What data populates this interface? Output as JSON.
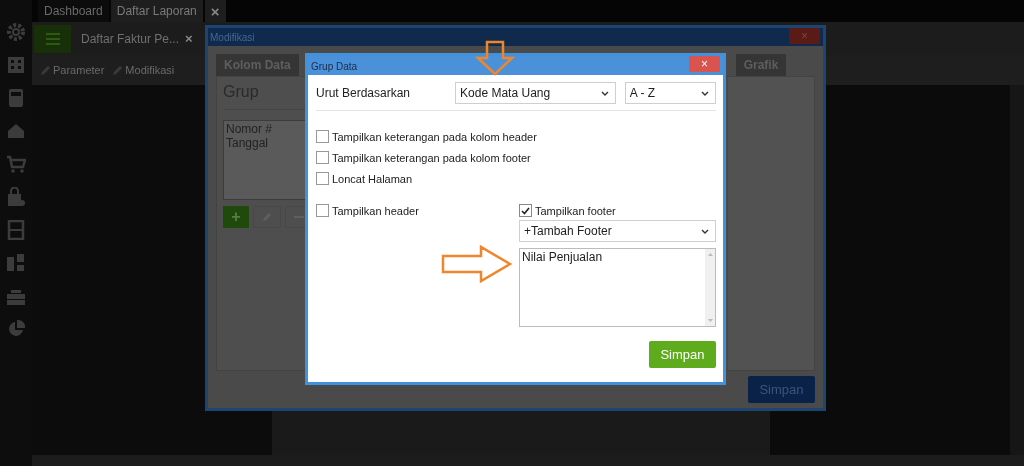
{
  "app_tabs": [
    {
      "label": "Dashboard",
      "selected": false
    },
    {
      "label": "Daftar Laporan",
      "selected": true
    }
  ],
  "app_tab_close": "×",
  "report_tab": {
    "title": "Daftar Faktur Pe...",
    "close": "×"
  },
  "toolbar": [
    {
      "label": "Parameter"
    },
    {
      "label": "Modifikasi"
    }
  ],
  "modify_dialog": {
    "title": "Modifikasi",
    "close": "×",
    "tabs": [
      {
        "label": "Kolom Data",
        "selected": false
      },
      {
        "label": "Grafik",
        "selected": false
      }
    ],
    "group_title": "Grup",
    "group_items": [
      "Nomor #",
      "Tanggal"
    ],
    "add": "+",
    "save": "Simpan"
  },
  "group_dialog": {
    "title": "Grup Data",
    "close": "×",
    "sort_label": "Urut Berdasarkan",
    "sort_field": "Kode Mata Uang",
    "sort_order": "A - Z",
    "options": [
      {
        "label": "Tampilkan keterangan pada kolom header",
        "checked": false
      },
      {
        "label": "Tampilkan keterangan pada kolom footer",
        "checked": false
      },
      {
        "label": "Loncat Halaman",
        "checked": false
      }
    ],
    "show_header": {
      "label": "Tampilkan header",
      "checked": false
    },
    "show_footer": {
      "label": "Tampilkan footer",
      "checked": true
    },
    "footer_select": "+Tambah Footer",
    "footer_items": [
      "Nilai Penjualan"
    ],
    "save": "Simpan"
  }
}
